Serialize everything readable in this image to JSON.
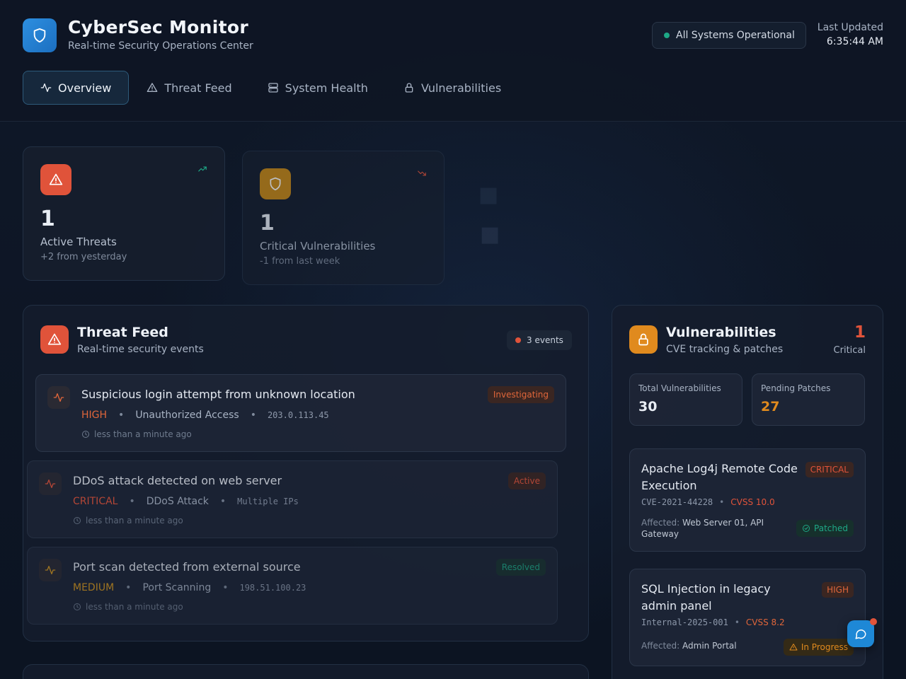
{
  "app": {
    "title": "CyberSec Monitor",
    "subtitle": "Real-time Security Operations Center",
    "status": "All Systems Operational",
    "last_updated_label": "Last Updated",
    "last_updated_time": "6:35:44 AM"
  },
  "tabs": [
    {
      "label": "Overview",
      "icon": "activity-icon",
      "active": true
    },
    {
      "label": "Threat Feed",
      "icon": "alert-triangle-icon",
      "active": false
    },
    {
      "label": "System Health",
      "icon": "server-icon",
      "active": false
    },
    {
      "label": "Vulnerabilities",
      "icon": "lock-icon",
      "active": false
    }
  ],
  "stats": [
    {
      "value": "1",
      "label": "Active Threats",
      "change": "+2 from yesterday",
      "color": "#e0533a",
      "icon": "alert-triangle-icon",
      "trend": "trending-up-icon"
    },
    {
      "value": "1",
      "label": "Critical Vulnerabilities",
      "change": "-1 from last week",
      "color": "#d99a1e",
      "icon": "shield-icon",
      "trend": "trending-down-icon"
    }
  ],
  "threat_feed": {
    "title": "Threat Feed",
    "subtitle": "Real-time security events",
    "count": "3 events",
    "events": [
      {
        "title": "Suspicious login attempt from unknown location",
        "severity": "HIGH",
        "category": "Unauthorized Access",
        "source": "203.0.113.45",
        "time": "less than a minute ago",
        "status": "Investigating"
      },
      {
        "title": "DDoS attack detected on web server",
        "severity": "CRITICAL",
        "category": "DDoS Attack",
        "source": "Multiple IPs",
        "time": "less than a minute ago",
        "status": "Active"
      },
      {
        "title": "Port scan detected from external source",
        "severity": "MEDIUM",
        "category": "Port Scanning",
        "source": "198.51.100.23",
        "time": "less than a minute ago",
        "status": "Resolved"
      }
    ]
  },
  "vulnerabilities": {
    "title": "Vulnerabilities",
    "subtitle": "CVE tracking & patches",
    "critical_count": "1",
    "critical_label": "Critical",
    "total_label": "Total Vulnerabilities",
    "total_value": "30",
    "pending_label": "Pending Patches",
    "pending_value": "27",
    "affected_label": "Affected:",
    "items": [
      {
        "title": "Apache Log4j Remote Code Execution",
        "severity": "CRITICAL",
        "id": "CVE-2021-44228",
        "cvss": "CVSS 10.0",
        "affected": "Web Server 01, API Gateway",
        "status": "Patched"
      },
      {
        "title": "SQL Injection in legacy admin panel",
        "severity": "HIGH",
        "id": "Internal-2025-001",
        "cvss": "CVSS 8.2",
        "affected": "Admin Portal",
        "status": "In Progress"
      }
    ]
  },
  "colors": {
    "critical": "#e0533a",
    "high": "#e0663a",
    "medium": "#d99a1e",
    "ok": "#1ea886",
    "accent": "#1e88d6"
  }
}
